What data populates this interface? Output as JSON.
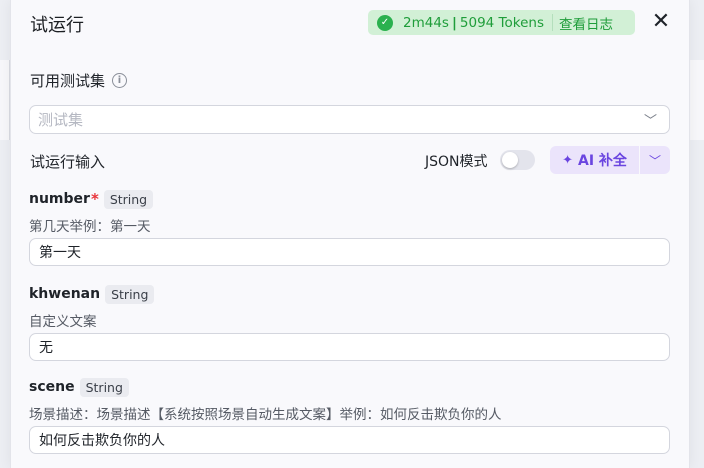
{
  "header": {
    "title": "试运行",
    "status": {
      "duration": "2m44s",
      "separator": "|",
      "tokens": "5094 Tokens",
      "log_link": "查看日志",
      "color": "#1f9d3a",
      "bg_color": "#d2f0d6"
    },
    "close_icon": "close-icon"
  },
  "test_set": {
    "title": "可用测试集",
    "info_icon": "info-icon",
    "placeholder": "测试集"
  },
  "run_input": {
    "label": "试运行输入",
    "json_mode_label": "JSON模式",
    "json_mode_on": false,
    "ai_button_label": "AI 补全",
    "accent_color": "#6a45e0"
  },
  "fields": [
    {
      "name": "number",
      "required_mark": "*",
      "type": "String",
      "description": "第几天举例：第一天",
      "value": "第一天"
    },
    {
      "name": "khwenan",
      "type": "String",
      "description": "自定义文案",
      "value": "无"
    },
    {
      "name": "scene",
      "type": "String",
      "description": "场景描述：场景描述【系统按照场景自动生成文案】举例：如何反击欺负你的人",
      "value": "如何反击欺负你的人"
    }
  ]
}
